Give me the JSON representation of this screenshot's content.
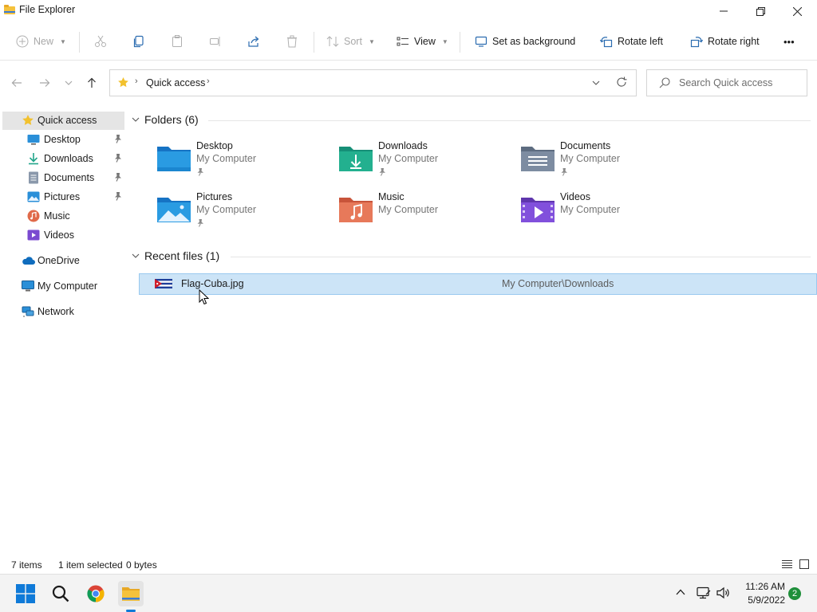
{
  "window": {
    "title": "File Explorer"
  },
  "toolbar": {
    "new_label": "New",
    "sort_label": "Sort",
    "view_label": "View",
    "set_background_label": "Set as background",
    "rotate_left_label": "Rotate left",
    "rotate_right_label": "Rotate right",
    "more_label": "•••"
  },
  "address": {
    "path": "Quick access",
    "search_placeholder": "Search Quick access"
  },
  "sidebar": {
    "items": [
      {
        "label": "Quick access",
        "icon": "star-icon"
      },
      {
        "label": "Desktop",
        "icon": "desktop-icon"
      },
      {
        "label": "Downloads",
        "icon": "download-icon"
      },
      {
        "label": "Documents",
        "icon": "document-icon"
      },
      {
        "label": "Pictures",
        "icon": "pictures-icon"
      },
      {
        "label": "Music",
        "icon": "music-icon"
      },
      {
        "label": "Videos",
        "icon": "videos-icon"
      },
      {
        "label": "OneDrive",
        "icon": "cloud-icon"
      },
      {
        "label": "My Computer",
        "icon": "computer-icon"
      },
      {
        "label": "Network",
        "icon": "network-icon"
      }
    ]
  },
  "main": {
    "folders_header": "Folders (6)",
    "recent_header": "Recent files (1)",
    "folders": [
      {
        "name": "Desktop",
        "location": "My Computer",
        "color": "#1e90d6"
      },
      {
        "name": "Downloads",
        "location": "My Computer",
        "color": "#21a58a"
      },
      {
        "name": "Documents",
        "location": "My Computer",
        "color": "#6f7f94"
      },
      {
        "name": "Pictures",
        "location": "My Computer",
        "color": "#2a8fd8"
      },
      {
        "name": "Music",
        "location": "My Computer",
        "color": "#e06a4a"
      },
      {
        "name": "Videos",
        "location": "My Computer",
        "color": "#7a4ad0"
      }
    ],
    "recent": [
      {
        "name": "Flag-Cuba.jpg",
        "path": "My Computer\\Downloads"
      }
    ]
  },
  "status": {
    "items": "7 items",
    "selected": "1 item selected",
    "size": "0 bytes"
  },
  "taskbar": {
    "time": "11:26 AM",
    "date": "5/9/2022",
    "notifications": "2"
  }
}
